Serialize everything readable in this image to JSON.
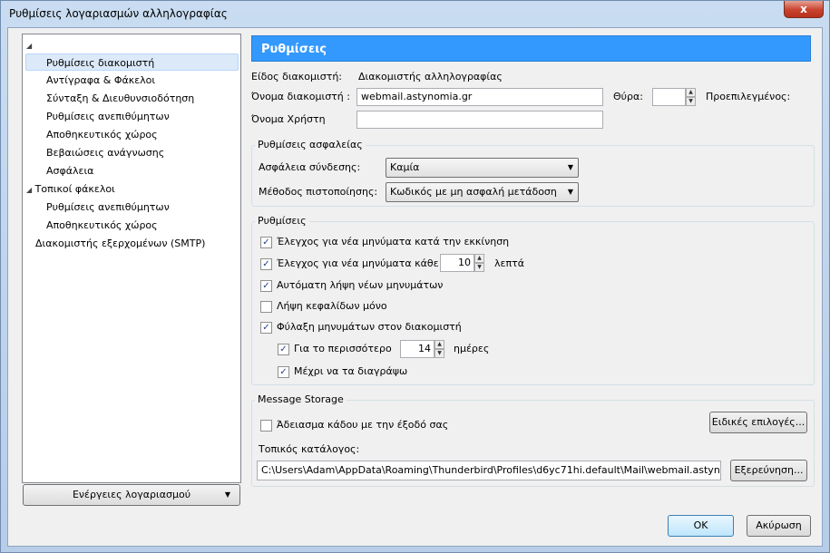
{
  "window": {
    "title": "Ρυθμίσεις λογαριασμών αλληλογραφίας",
    "close_glyph": "x"
  },
  "tree": {
    "root_twisty": "◢",
    "items": [
      {
        "label": "Ρυθμίσεις διακομιστή"
      },
      {
        "label": "Αντίγραφα & Φάκελοι"
      },
      {
        "label": "Σύνταξη & Διευθυνσιοδότηση"
      },
      {
        "label": "Ρυθμίσεις ανεπιθύμητων"
      },
      {
        "label": "Αποθηκευτικός χώρος"
      },
      {
        "label": "Βεβαιώσεις ανάγνωσης"
      },
      {
        "label": "Ασφάλεια"
      },
      {
        "label": "Τοπικοί φάκελοι",
        "twisty": "◢"
      },
      {
        "label": "Ρυθμίσεις ανεπιθύμητων"
      },
      {
        "label": "Αποθηκευτικός χώρος"
      },
      {
        "label": "Διακομιστής εξερχομένων (SMTP)"
      }
    ]
  },
  "account_actions": {
    "label": "Ενέργειες λογαριασμού",
    "arrow": "▼"
  },
  "panel": {
    "header": "Ρυθμίσεις",
    "server_type_label": "Είδος διακομιστή:",
    "server_type_value": "Διακομιστής αλληλογραφίας",
    "server_name_label": "Όνομα διακομιστή :",
    "server_name_value": "webmail.astynomia.gr",
    "port_label": "Θύρα:",
    "port_value": "",
    "default_label": "Προεπιλεγμένος:",
    "username_label": "Όνομα Χρήστη",
    "username_value": ""
  },
  "security": {
    "title": "Ρυθμίσεις ασφαλείας",
    "conn_label": "Ασφάλεια σύνδεσης:",
    "conn_value": "Καμία",
    "auth_label": "Μέθοδος πιστοποίησης:",
    "auth_value": "Κωδικός με μη ασφαλή μετάδοση",
    "arrow": "▼"
  },
  "settings": {
    "title": "Ρυθμίσεις",
    "check_startup": {
      "label": "Έλεγχος για νέα μηνύματα κατά την εκκίνηση",
      "checked": true
    },
    "check_every": {
      "label": "Έλεγχος για νέα μηνύματα κάθε",
      "checked": true,
      "value": "10",
      "unit": "λεπτά"
    },
    "auto_download": {
      "label": "Αυτόματη λήψη νέων μηνυμάτων",
      "checked": true
    },
    "headers_only": {
      "label": "Λήψη κεφαλίδων μόνο",
      "checked": false
    },
    "leave_on_server": {
      "label": "Φύλαξη μηνυμάτων στον διακομιστή",
      "checked": true
    },
    "at_most": {
      "label": "Για το περισσότερο",
      "checked": true,
      "value": "14",
      "unit": "ημέρες"
    },
    "until_delete": {
      "label": "Μέχρι να τα διαγράψω",
      "checked": true
    },
    "check_glyph": "✓",
    "spin_up": "▲",
    "spin_down": "▼"
  },
  "storage": {
    "title": "Message Storage",
    "empty_trash": {
      "label": "Άδειασμα κάδου με την έξοδό σας",
      "checked": false
    },
    "advanced_button": "Ειδικές επιλογές...",
    "local_dir_label": "Τοπικός κατάλογος:",
    "local_dir_value": "C:\\Users\\Adam\\AppData\\Roaming\\Thunderbird\\Profiles\\d6yc71hi.default\\Mail\\webmail.astyno",
    "browse_button": "Εξερεύνηση..."
  },
  "footer": {
    "ok": "OK",
    "cancel": "Ακύρωση"
  }
}
